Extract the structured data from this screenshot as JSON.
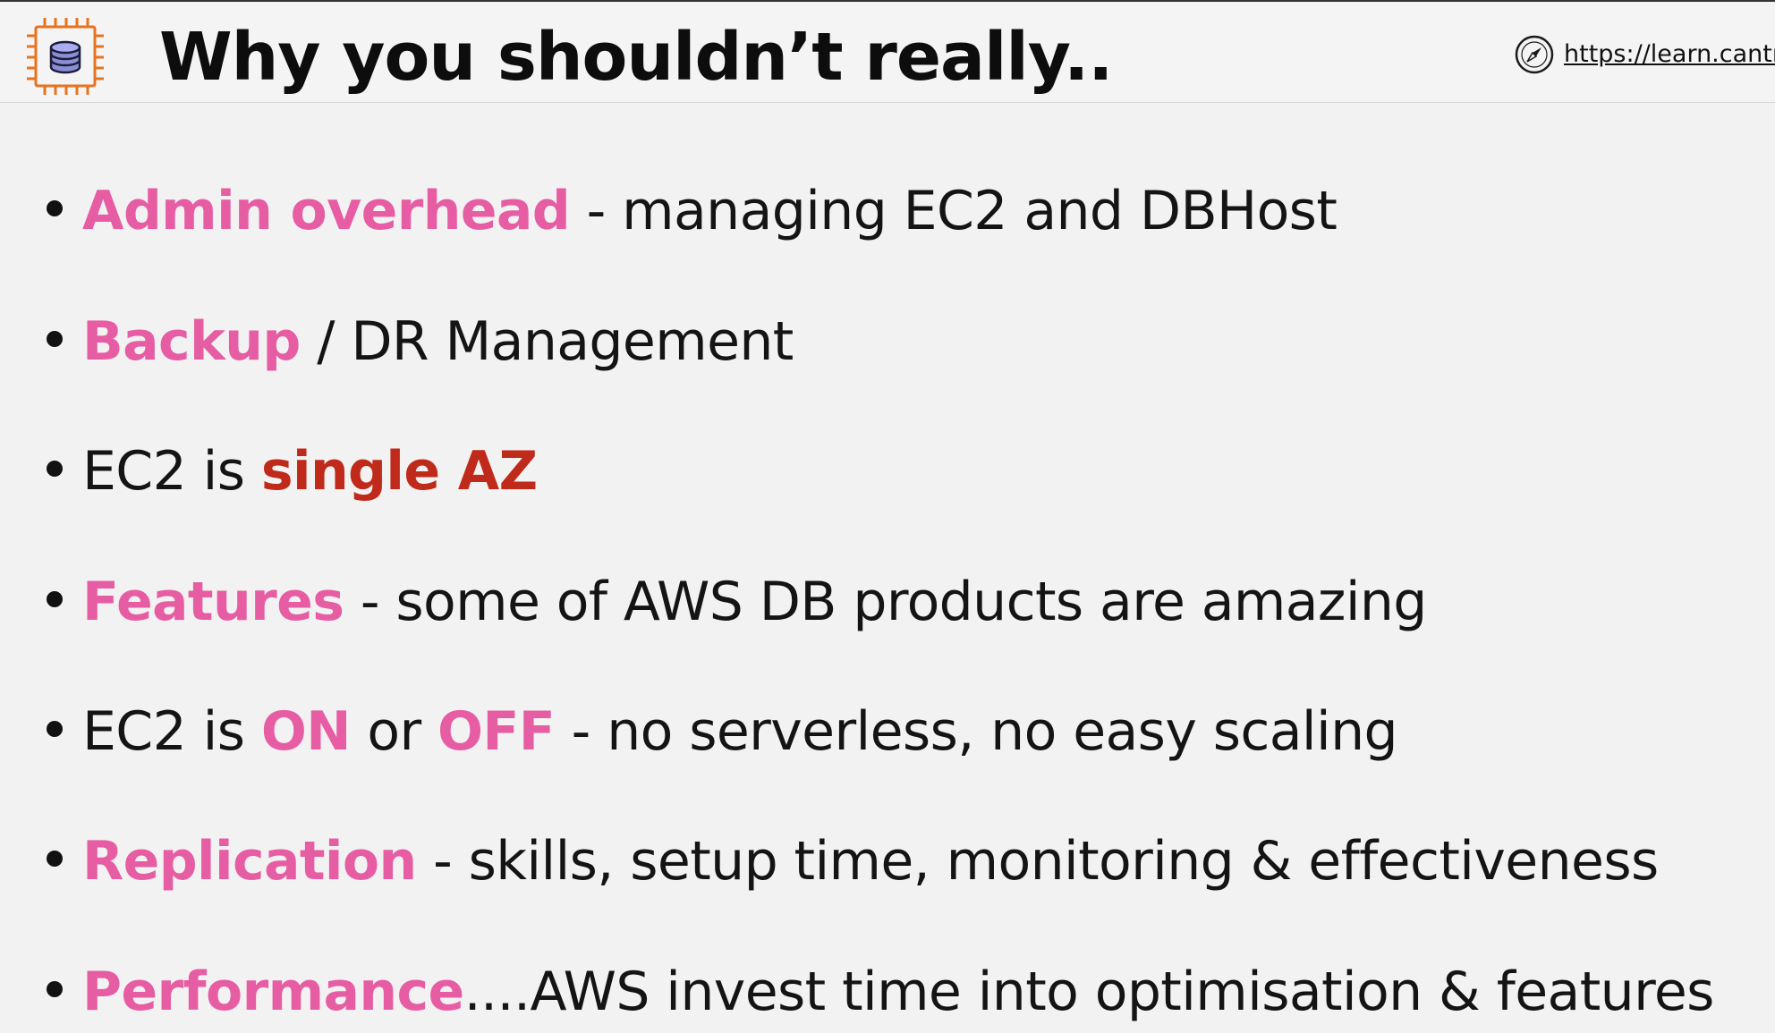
{
  "header": {
    "title": "Why you shouldn’t really..",
    "url": "https://learn.cantrill.i",
    "logo_icon": "database-chip-icon",
    "url_icon": "compass-icon"
  },
  "colors": {
    "highlight_pink": "#e65da3",
    "highlight_red": "#bf2a1a",
    "text": "#141414",
    "logo_orange": "#e8731e"
  },
  "bullets": [
    {
      "pre": "",
      "hl1": "Admin overhead",
      "mid": " - managing EC2 and DBHost",
      "hl2": "",
      "post": ""
    },
    {
      "pre": "",
      "hl1": "Backup",
      "mid": " / DR Management",
      "hl2": "",
      "post": ""
    },
    {
      "pre": "EC2 is ",
      "hl1": "single AZ",
      "mid": "",
      "hl2": "",
      "post": ""
    },
    {
      "pre": "",
      "hl1": "Features",
      "mid": " - some of AWS DB products are amazing",
      "hl2": "",
      "post": ""
    },
    {
      "pre": "EC2 is ",
      "hl1": "ON",
      "mid": " or ",
      "hl2": "OFF",
      "post": " - no serverless, no easy scaling"
    },
    {
      "pre": "",
      "hl1": "Replication",
      "mid": " - skills, setup time, monitoring & effectiveness",
      "hl2": "",
      "post": ""
    },
    {
      "pre": "",
      "hl1": "Performance",
      "mid": "....AWS invest time into optimisation & features",
      "hl2": "",
      "post": ""
    }
  ]
}
